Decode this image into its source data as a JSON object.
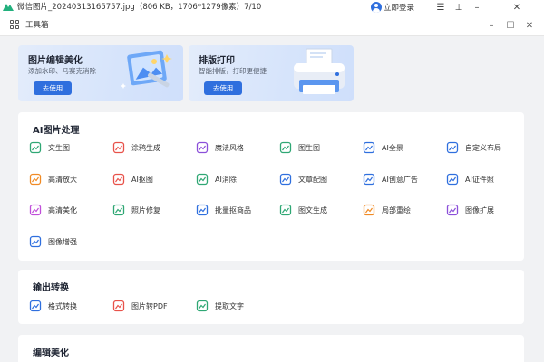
{
  "window": {
    "title": "微信图片_20240313165757.jpg（806 KB，1706*1279像素）7/10",
    "login_label": "立即登录",
    "colors": {
      "accent": "#2f6fde",
      "logo_green": "#22b07d"
    }
  },
  "window_controls": [
    {
      "name": "menu",
      "icon": "menu-icon",
      "glyph": "☰"
    },
    {
      "name": "pin",
      "icon": "pin-icon",
      "glyph": "⊥"
    },
    {
      "name": "minimize",
      "icon": "minimize-icon",
      "glyph": "–"
    },
    {
      "name": "close",
      "icon": "close-icon",
      "glyph": "✕"
    }
  ],
  "toolbar": {
    "title": "工具箱",
    "controls": [
      {
        "name": "minimize",
        "glyph": "–"
      },
      {
        "name": "maximize",
        "glyph": "☐"
      },
      {
        "name": "close",
        "glyph": "✕"
      }
    ]
  },
  "banners": [
    {
      "title": "图片编辑美化",
      "subtitle": "添加水印、马赛克消除",
      "button": "去使用",
      "icon": "image-edit-illustration"
    },
    {
      "title": "排版打印",
      "subtitle": "智能排版，打印更便捷",
      "button": "去使用",
      "icon": "printer-illustration"
    }
  ],
  "sections": [
    {
      "title": "AI图片处理",
      "tools": [
        {
          "label": "文生图",
          "icon": "text-to-image-icon",
          "color": "#2fa774"
        },
        {
          "label": "涂鸦生成",
          "icon": "palette-icon",
          "color": "#e8524a"
        },
        {
          "label": "魔法风格",
          "icon": "magic-sparkle-icon",
          "color": "#8b4fd9"
        },
        {
          "label": "图生图",
          "icon": "image-to-image-icon",
          "color": "#2fa774"
        },
        {
          "label": "AI全景",
          "icon": "panorama-icon",
          "color": "#2f6fde"
        },
        {
          "label": "自定义布局",
          "icon": "custom-layout-icon",
          "color": "#2f6fde"
        },
        {
          "label": "高清放大",
          "icon": "upscale-icon",
          "color": "#f08a24"
        },
        {
          "label": "AI抠图",
          "icon": "cutout-icon",
          "color": "#e8524a"
        },
        {
          "label": "AI消除",
          "icon": "erase-icon",
          "color": "#2fa774"
        },
        {
          "label": "文章配图",
          "icon": "article-image-icon",
          "color": "#2f6fde"
        },
        {
          "label": "AI创意广告",
          "icon": "creative-ad-icon",
          "color": "#2f6fde"
        },
        {
          "label": "AI证件照",
          "icon": "id-photo-icon",
          "color": "#2f6fde"
        },
        {
          "label": "高清美化",
          "icon": "beautify-icon",
          "color": "#c04fd9"
        },
        {
          "label": "照片修复",
          "icon": "photo-repair-icon",
          "color": "#2fa774"
        },
        {
          "label": "批量抠商品",
          "icon": "batch-cutout-icon",
          "color": "#2f6fde"
        },
        {
          "label": "图文生成",
          "icon": "image-text-icon",
          "color": "#2fa774"
        },
        {
          "label": "局部重绘",
          "icon": "partial-redraw-icon",
          "color": "#f08a24"
        },
        {
          "label": "图像扩展",
          "icon": "image-expand-icon",
          "color": "#8b4fd9"
        },
        {
          "label": "图像增强",
          "icon": "enhance-4k-icon",
          "color": "#2f6fde"
        }
      ]
    },
    {
      "title": "输出转换",
      "tools": [
        {
          "label": "格式转换",
          "icon": "format-convert-icon",
          "color": "#2f6fde"
        },
        {
          "label": "图片转PDF",
          "icon": "image-to-pdf-icon",
          "color": "#e8524a"
        },
        {
          "label": "提取文字",
          "icon": "extract-text-icon",
          "color": "#2fa774"
        }
      ]
    },
    {
      "title": "编辑美化",
      "tools": []
    }
  ]
}
